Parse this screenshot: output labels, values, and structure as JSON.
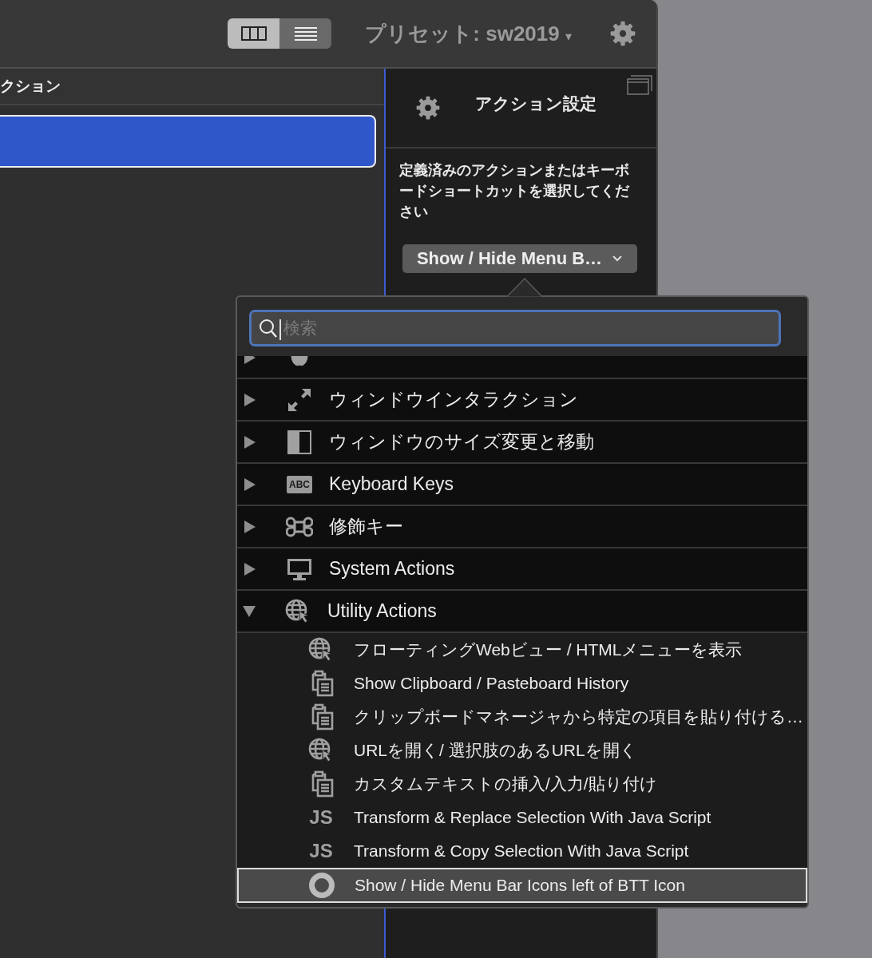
{
  "toolbar": {
    "view_modes": [
      {
        "kind": "columns",
        "selected": true
      },
      {
        "kind": "lines",
        "selected": false
      }
    ],
    "preset": "プリセット: sw2019",
    "preset_caret": "▾"
  },
  "left_panel": {
    "header": "クション",
    "rows": [
      {
        "selected": true
      }
    ]
  },
  "action_panel": {
    "title": "アクション設定",
    "instruction": "定義済みのアクションまたはキーボードショートカットを選択してください",
    "action_button": "Show / Hide Menu B…"
  },
  "popup": {
    "search": {
      "placeholder": "検索"
    },
    "categories": [
      {
        "kind": "apple",
        "expanded": false
      },
      {
        "label": "ウィンドウインタラクション",
        "kind": "resize",
        "expanded": false
      },
      {
        "label": "ウィンドウのサイズ変更と移動",
        "kind": "split",
        "expanded": false
      },
      {
        "label": "Keyboard Keys",
        "kind": "text",
        "icon_text": "ABC",
        "expanded": false
      },
      {
        "label": "修飾キー",
        "kind": "command",
        "expanded": false
      },
      {
        "label": "System Actions",
        "kind": "monitor",
        "expanded": false
      },
      {
        "label": "Utility Actions",
        "kind": "globe",
        "expanded": true,
        "children": [
          {
            "label": "フローティングWebビュー / HTMLメニューを表示",
            "kind": "globe",
            "selected": false
          },
          {
            "label": "Show Clipboard / Pasteboard History",
            "kind": "clipboard",
            "selected": false
          },
          {
            "label": "クリップボードマネージャから特定の項目を貼り付ける…",
            "kind": "clipboard",
            "selected": false
          },
          {
            "label": "URLを開く/ 選択肢のあるURLを開く",
            "kind": "globe",
            "selected": false
          },
          {
            "label": "カスタムテキストの挿入/入力/貼り付け",
            "kind": "clipboard",
            "selected": false
          },
          {
            "label": "Transform & Replace Selection With Java Script",
            "kind": "text",
            "icon_text": "JS",
            "selected": false
          },
          {
            "label": "Transform & Copy Selection With Java Script",
            "kind": "text",
            "icon_text": "JS",
            "selected": false
          },
          {
            "label": "Show / Hide Menu Bar Icons left of BTT Icon",
            "kind": "disc",
            "selected": true
          }
        ]
      }
    ]
  }
}
